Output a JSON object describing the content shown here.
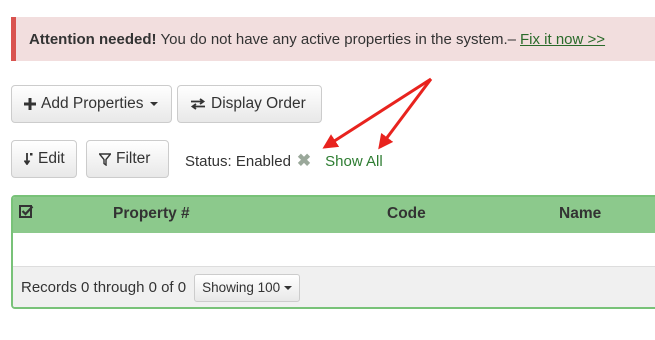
{
  "alert": {
    "title": "Attention needed!",
    "message": "You do not have any active properties in the system.–",
    "link": "Fix it now >>"
  },
  "toolbar": {
    "add_properties_label": "Add Properties",
    "display_order_label": "Display Order",
    "edit_label": "Edit",
    "filter_label": "Filter"
  },
  "status": {
    "label": "Status: Enabled",
    "clear_icon": "x-icon",
    "show_all_label": "Show All"
  },
  "table": {
    "columns": [
      "Property #",
      "Code",
      "Name"
    ],
    "rows": []
  },
  "footer": {
    "records_text": "Records 0 through 0 of 0",
    "showing_label": "Showing 100"
  },
  "colors": {
    "alert_bg": "#f2dede",
    "alert_border": "#d9534f",
    "header_green": "#8cc98c",
    "link_green": "#2e7d32",
    "arrow_red": "#e8231e"
  }
}
